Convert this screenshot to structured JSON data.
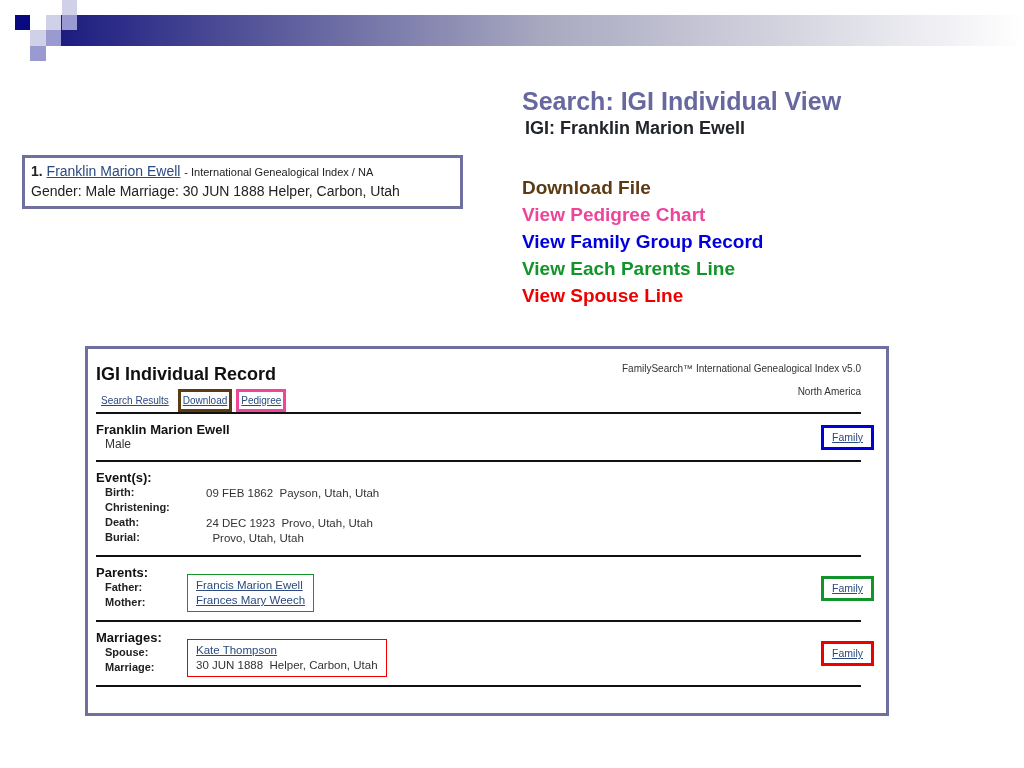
{
  "title": "Search:  IGI Individual View",
  "subtitle": "IGI:  Franklin Marion Ewell",
  "legend": [
    {
      "label": "Download File",
      "color": "#5c3a12"
    },
    {
      "label": "View Pedigree Chart",
      "color": "#ee4499"
    },
    {
      "label": "View Family Group Record",
      "color": "#0000dd"
    },
    {
      "label": "View Each Parents Line",
      "color": "#11952a"
    },
    {
      "label": "View Spouse Line",
      "color": "#ee0000"
    }
  ],
  "search_result": {
    "number": "1.",
    "name": "Franklin Marion Ewell",
    "source": "- International Genealogical Index / NA",
    "details": "Gender: Male Marriage: 30 JUN 1888 Helper, Carbon, Utah"
  },
  "record": {
    "title": "IGI Individual Record",
    "source": "FamilySearch™ International Genealogical Index v5.0",
    "region": "North America",
    "links": [
      {
        "label": "Search Results"
      },
      {
        "label": "Download",
        "color": "#5c3a12"
      },
      {
        "label": "Pedigree",
        "color": "#ee4499"
      }
    ],
    "person": {
      "name": "Franklin Marion Ewell",
      "gender": "Male",
      "family_link": {
        "label": "Family",
        "color": "#0000dd"
      }
    },
    "sections": [
      {
        "heading": "Event(s):",
        "rows": [
          {
            "label": "Birth:",
            "value": "09 FEB 1862  Payson, Utah, Utah",
            "kind": "text"
          },
          {
            "label": "Christening:"
          },
          {
            "label": "Death:",
            "value": "24 DEC 1923  Provo, Utah, Utah",
            "kind": "text"
          },
          {
            "label": "Burial:",
            "value": "  Provo, Utah, Utah",
            "kind": "text"
          }
        ]
      },
      {
        "heading": "Parents:",
        "color": "#11952a",
        "rows": [
          {
            "label": "Father:",
            "value": "Francis Marion Ewell",
            "kind": "link"
          },
          {
            "label": "Mother:",
            "value": "Frances Mary Weech",
            "kind": "link"
          }
        ],
        "family_link": {
          "label": "Family",
          "color": "#11952a"
        }
      },
      {
        "heading": "Marriages:",
        "color": "#ee0000",
        "rows": [
          {
            "label": "Spouse:",
            "value": "Kate Thompson",
            "kind": "link"
          },
          {
            "label": "Marriage:",
            "value": "30 JUN 1888  Helper, Carbon, Utah",
            "kind": "text"
          }
        ],
        "family_link": {
          "label": "Family",
          "color": "#ee0000"
        }
      }
    ]
  }
}
